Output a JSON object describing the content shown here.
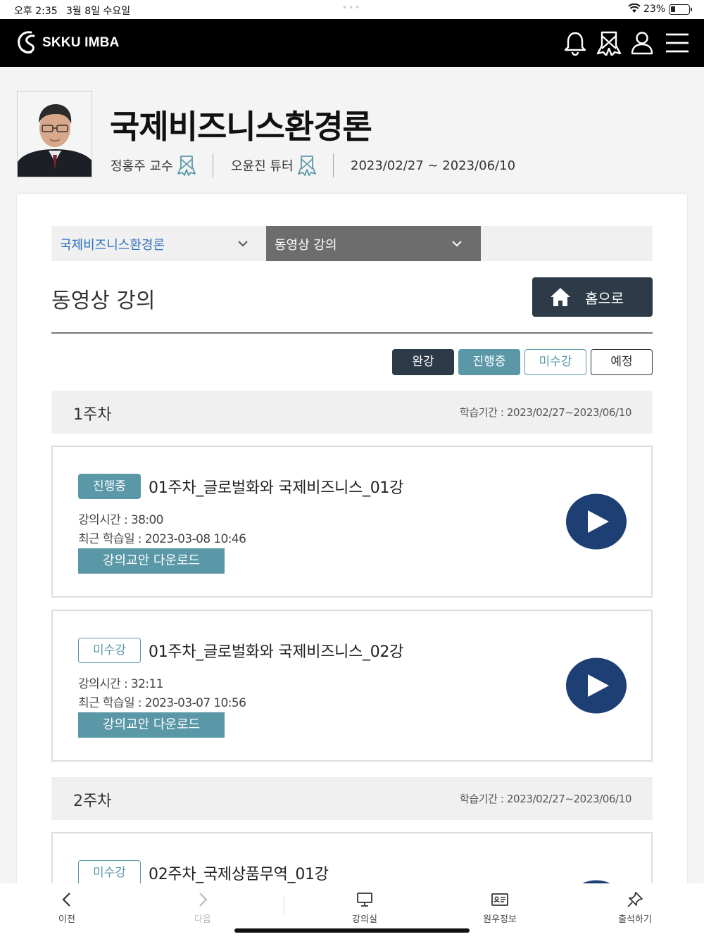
{
  "status_bar": {
    "time": "오후 2:35",
    "date": "3월 8일 수요일",
    "battery": "23%"
  },
  "header": {
    "logo_text": "SKKU IMBA",
    "icons": [
      "bell-icon",
      "ribbon-icon",
      "user-icon",
      "menu-icon"
    ]
  },
  "course": {
    "title": "국제비즈니스환경론",
    "professor": "정홍주 교수",
    "tutor": "오윤진 튜터",
    "period": "2023/02/27 ~ 2023/06/10"
  },
  "selectors": {
    "course_select": "국제비즈니스환경론",
    "menu_select": "동영상 강의"
  },
  "section": {
    "title": "동영상 강의",
    "home_label": "홈으로"
  },
  "filters": {
    "done": "완강",
    "in_progress": "진행중",
    "not_taken": "미수강",
    "planned": "예정"
  },
  "weeks": [
    {
      "name": "1주차",
      "period": "학습기간 : 2023/02/27~2023/06/10"
    },
    {
      "name": "2주차",
      "period": "학습기간 : 2023/02/27~2023/06/10"
    }
  ],
  "lectures": [
    {
      "badge": "진행중",
      "title": "01주차_글로벌화와 국제비즈니스_01강",
      "duration": "강의시간 : 38:00",
      "last_study": "최근 학습일 : 2023-03-08 10:46",
      "download": "강의교안 다운로드"
    },
    {
      "badge": "미수강",
      "title": "01주차_글로벌화와 국제비즈니스_02강",
      "duration": "강의시간 : 32:11",
      "last_study": "최근 학습일 : 2023-03-07 10:56",
      "download": "강의교안 다운로드"
    },
    {
      "badge": "미수강",
      "title": "02주차_국제상품무역_01강"
    }
  ],
  "bottom_nav": {
    "prev": "이전",
    "next": "다음",
    "classroom": "강의실",
    "student_info": "원우정보",
    "attendance": "출석하기"
  },
  "colors": {
    "header_bg": "#000000",
    "dark_button": "#2d3b48",
    "teal": "#5a98a8",
    "play_button": "#1d3f73",
    "select_active": "#6d6d6d",
    "link_blue": "#2d6fc0"
  }
}
